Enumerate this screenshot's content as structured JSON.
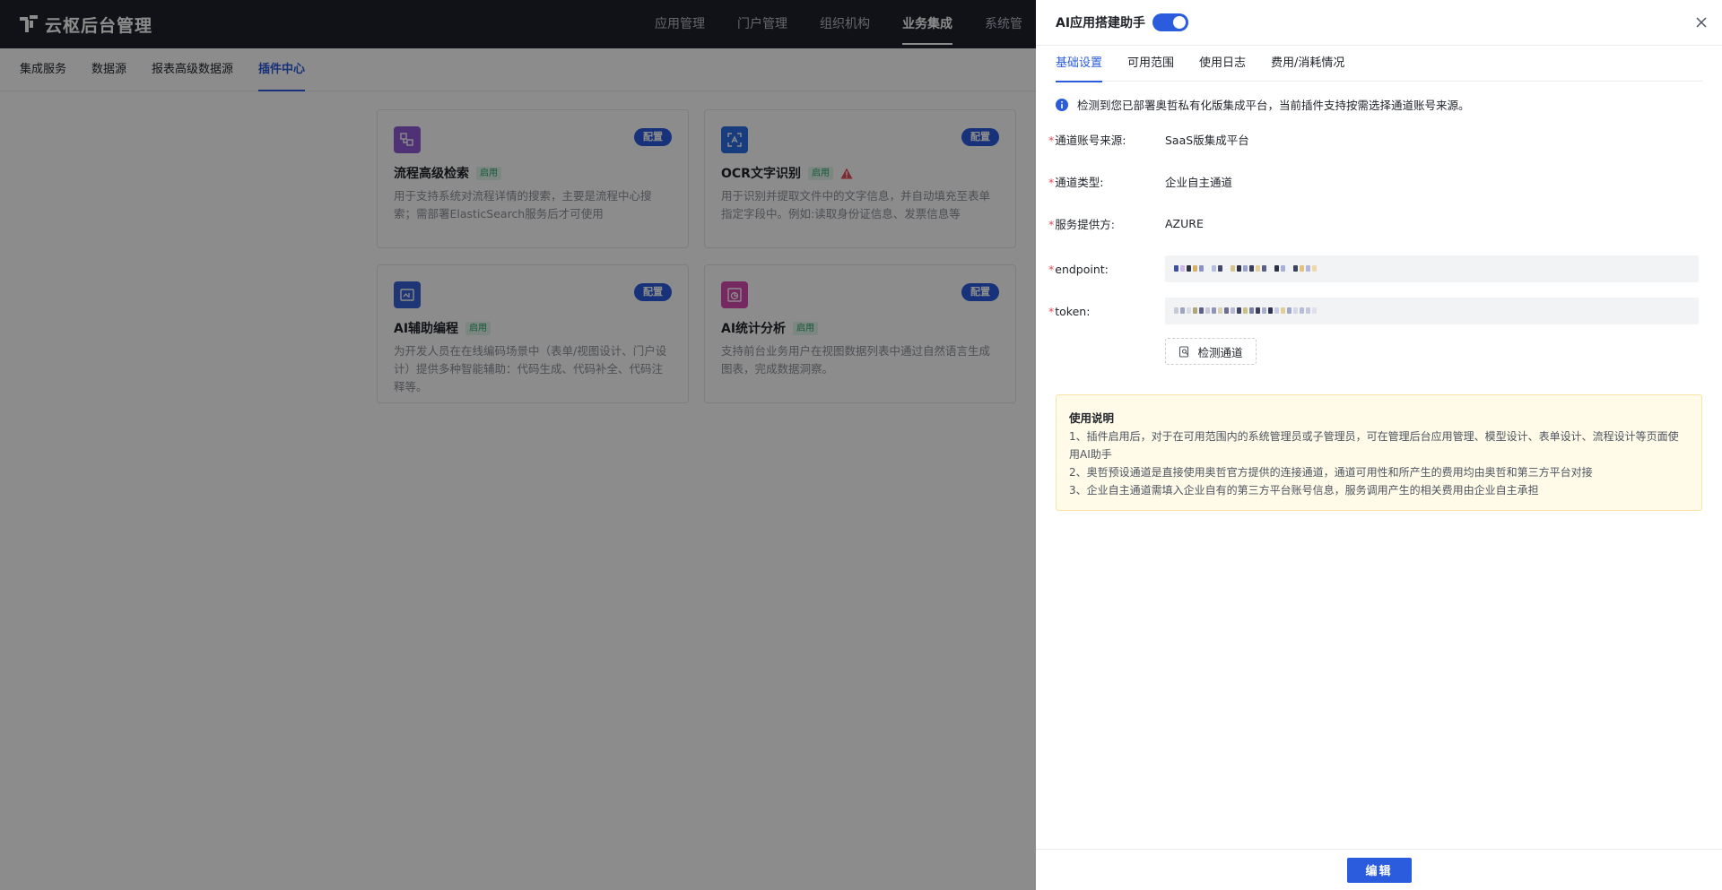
{
  "app": {
    "title": "云枢后台管理",
    "top_nav": [
      "应用管理",
      "门户管理",
      "组织机构",
      "业务集成",
      "系统管"
    ],
    "top_nav_active": "业务集成",
    "sub_nav": [
      "集成服务",
      "数据源",
      "报表高级数据源",
      "插件中心"
    ],
    "sub_nav_active": "插件中心"
  },
  "cards": [
    {
      "title": "流程高级检索",
      "status": "启用",
      "config_label": "配置",
      "icon": "search-flow-icon",
      "icon_color": "#8e5bd6",
      "warning": false,
      "desc": "用于支持系统对流程详情的搜索，主要是流程中心搜索；需部署ElasticSearch服务后才可使用"
    },
    {
      "title": "OCR文字识别",
      "status": "启用",
      "config_label": "配置",
      "icon": "ocr-scan-icon",
      "icon_color": "#2b6fe6",
      "warning": true,
      "desc": "用于识别并提取文件中的文字信息，并自动填充至表单指定字段中。例如:读取身份证信息、发票信息等"
    },
    {
      "title": "AI辅助编程",
      "status": "启用",
      "config_label": "配置",
      "icon": "ai-code-icon",
      "icon_color": "#3a63d8",
      "warning": false,
      "desc": "为开发人员在在线编码场景中（表单/视图设计、门户设计）提供多种智能辅助：代码生成、代码补全、代码注释等。"
    },
    {
      "title": "AI统计分析",
      "status": "启用",
      "config_label": "配置",
      "icon": "ai-chart-icon",
      "icon_color": "#d64bb0",
      "warning": false,
      "desc": "支持前台业务用户在视图数据列表中通过自然语言生成图表，完成数据洞察。"
    }
  ],
  "drawer": {
    "title": "AI应用搭建助手",
    "enabled": true,
    "tabs": [
      "基础设置",
      "可用范围",
      "使用日志",
      "费用/消耗情况"
    ],
    "active_tab": "基础设置",
    "notice": "检测到您已部署奥哲私有化版集成平台，当前插件支持按需选择通道账号来源。",
    "fields": {
      "source_label": "通道账号来源:",
      "source_value": "SaaS版集成平台",
      "type_label": "通道类型:",
      "type_value": "企业自主通道",
      "provider_label": "服务提供方:",
      "provider_value": "AZURE",
      "endpoint_label": "endpoint:",
      "token_label": "token:"
    },
    "check_button": "检测通道",
    "usage": {
      "title": "使用说明",
      "lines": [
        "1、插件启用后，对于在可用范围内的系统管理员或子管理员，可在管理后台应用管理、模型设计、表单设计、流程设计等页面使用AI助手",
        "2、奥哲预设通道是直接使用奥哲官方提供的连接通道，通道可用性和所产生的费用均由奥哲和第三方平台对接",
        "3、企业自主通道需填入企业自有的第三方平台账号信息，服务调用产生的相关费用由企业自主承担"
      ]
    },
    "edit_button": "编辑"
  },
  "colors": {
    "primary": "#2b5cde",
    "topbar": "#1e222b",
    "required": "#e34d59",
    "status_green": "#2aa56a",
    "warning_red": "#e34d59"
  }
}
